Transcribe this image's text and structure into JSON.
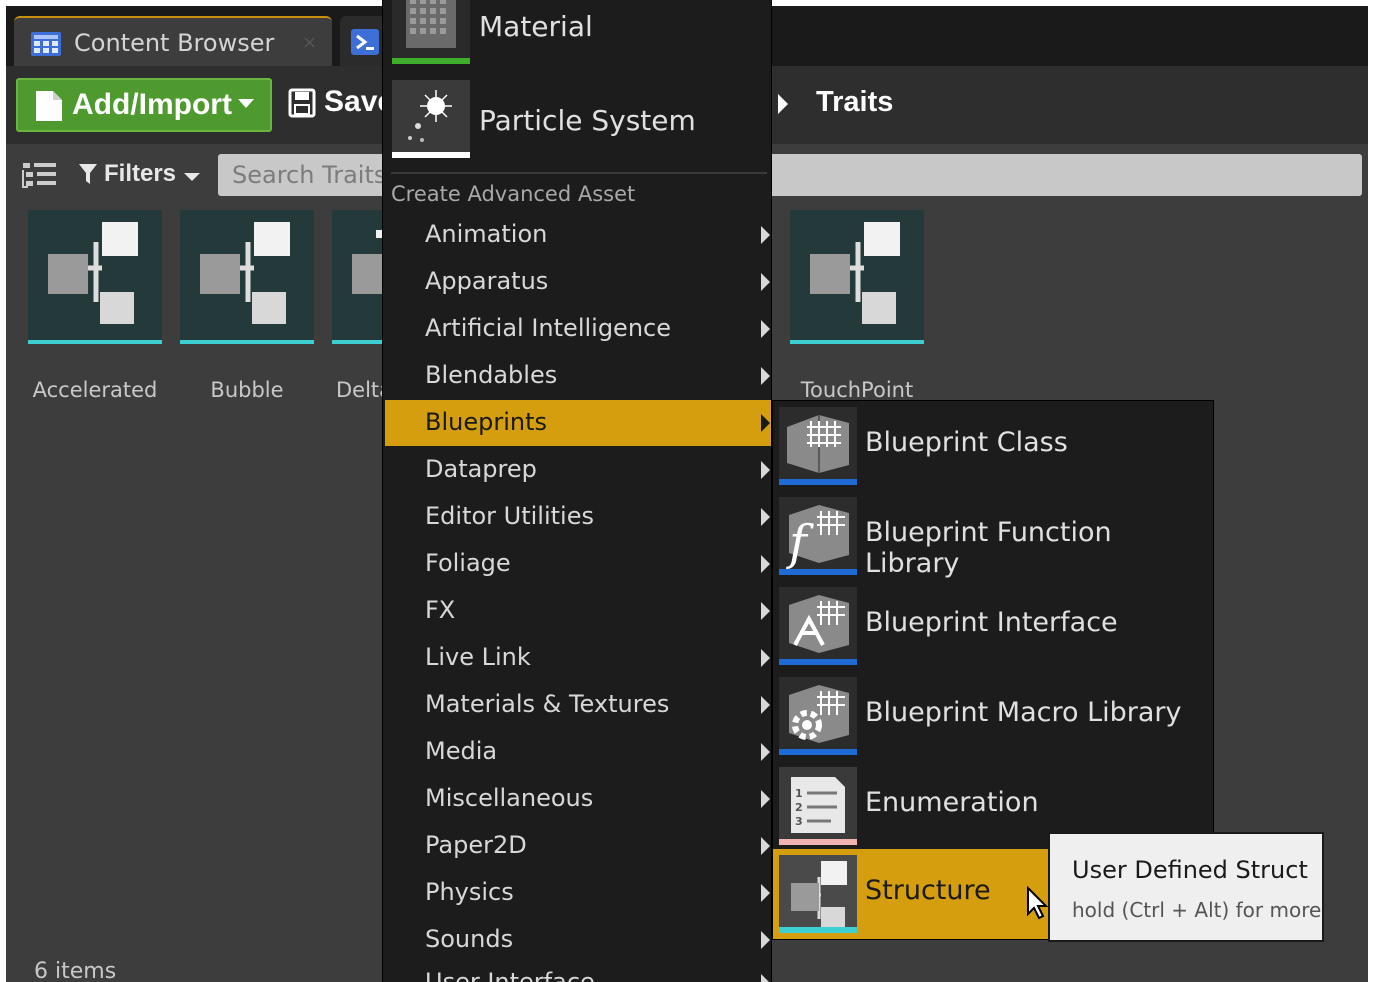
{
  "tab": {
    "title": "Content Browser",
    "close": "×"
  },
  "toolbar": {
    "add_label": "Add/Import",
    "save_label": "Save"
  },
  "path": {
    "current": "Traits"
  },
  "filters": {
    "label": "Filters",
    "search_placeholder": "Search Traits"
  },
  "assets": [
    {
      "label": "Accelerated"
    },
    {
      "label": "Bubble"
    },
    {
      "label": "Delta"
    },
    {
      "label": "TouchPoint"
    }
  ],
  "status": {
    "count": "6 items"
  },
  "menu": {
    "top_items": [
      {
        "label": "Material"
      },
      {
        "label": "Particle System"
      }
    ],
    "heading": "Create Advanced Asset",
    "items": [
      {
        "label": "Animation"
      },
      {
        "label": "Apparatus"
      },
      {
        "label": "Artificial Intelligence"
      },
      {
        "label": "Blendables"
      },
      {
        "label": "Blueprints"
      },
      {
        "label": "Dataprep"
      },
      {
        "label": "Editor Utilities"
      },
      {
        "label": "Foliage"
      },
      {
        "label": "FX"
      },
      {
        "label": "Live Link"
      },
      {
        "label": "Materials & Textures"
      },
      {
        "label": "Media"
      },
      {
        "label": "Miscellaneous"
      },
      {
        "label": "Paper2D"
      },
      {
        "label": "Physics"
      },
      {
        "label": "Sounds"
      },
      {
        "label": "User Interface"
      }
    ]
  },
  "submenu": {
    "items": [
      {
        "label": "Blueprint Class"
      },
      {
        "label": "Blueprint Function Library"
      },
      {
        "label": "Blueprint Interface"
      },
      {
        "label": "Blueprint Macro Library"
      },
      {
        "label": "Enumeration"
      },
      {
        "label": "Structure"
      }
    ]
  },
  "tooltip": {
    "title": "User Defined Struct",
    "hint": "hold (Ctrl + Alt) for more"
  },
  "colors": {
    "highlight": "#d59e0f",
    "add_button": "#4e9a2f",
    "asset_underline": "#3ecfd2",
    "blueprint_underline": "#1e6bd6"
  }
}
